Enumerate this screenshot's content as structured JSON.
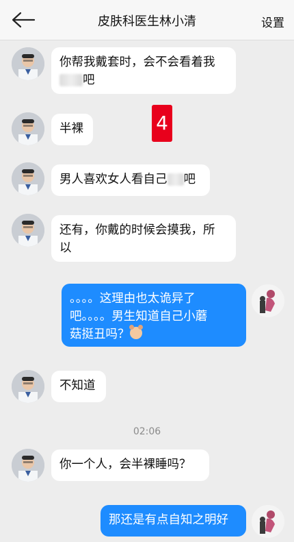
{
  "header": {
    "title": "皮肤科医生林小清",
    "settings_label": "设置",
    "back_icon": "back-arrow-icon"
  },
  "badge": {
    "text": "4",
    "color": "#e8001c"
  },
  "colors": {
    "outgoing_bubble": "#1e8cff",
    "incoming_bubble": "#ffffff",
    "background": "#ededed"
  },
  "messages": [
    {
      "from": "doctor",
      "line1": "你帮我戴套时，会不会看着我",
      "line2": "吧"
    },
    {
      "from": "doctor",
      "text": "半裸"
    },
    {
      "from": "doctor",
      "text": "男人喜欢女人看自己",
      "tail": "吧"
    },
    {
      "from": "doctor",
      "line1": "还有，你戴的时候会摸我，所",
      "line2": "以"
    },
    {
      "from": "me",
      "line1": "。。。。这理由也太诡异了",
      "line2": "吧。。。。男生知道自己小蘑",
      "line3": "菇挺丑吗？"
    },
    {
      "from": "doctor",
      "text": "不知道"
    },
    {
      "from": "doctor",
      "text": "你一个人，会半裸睡吗？"
    },
    {
      "from": "me",
      "text": "那还是有点自知之明好"
    }
  ],
  "timestamp": "02:06"
}
